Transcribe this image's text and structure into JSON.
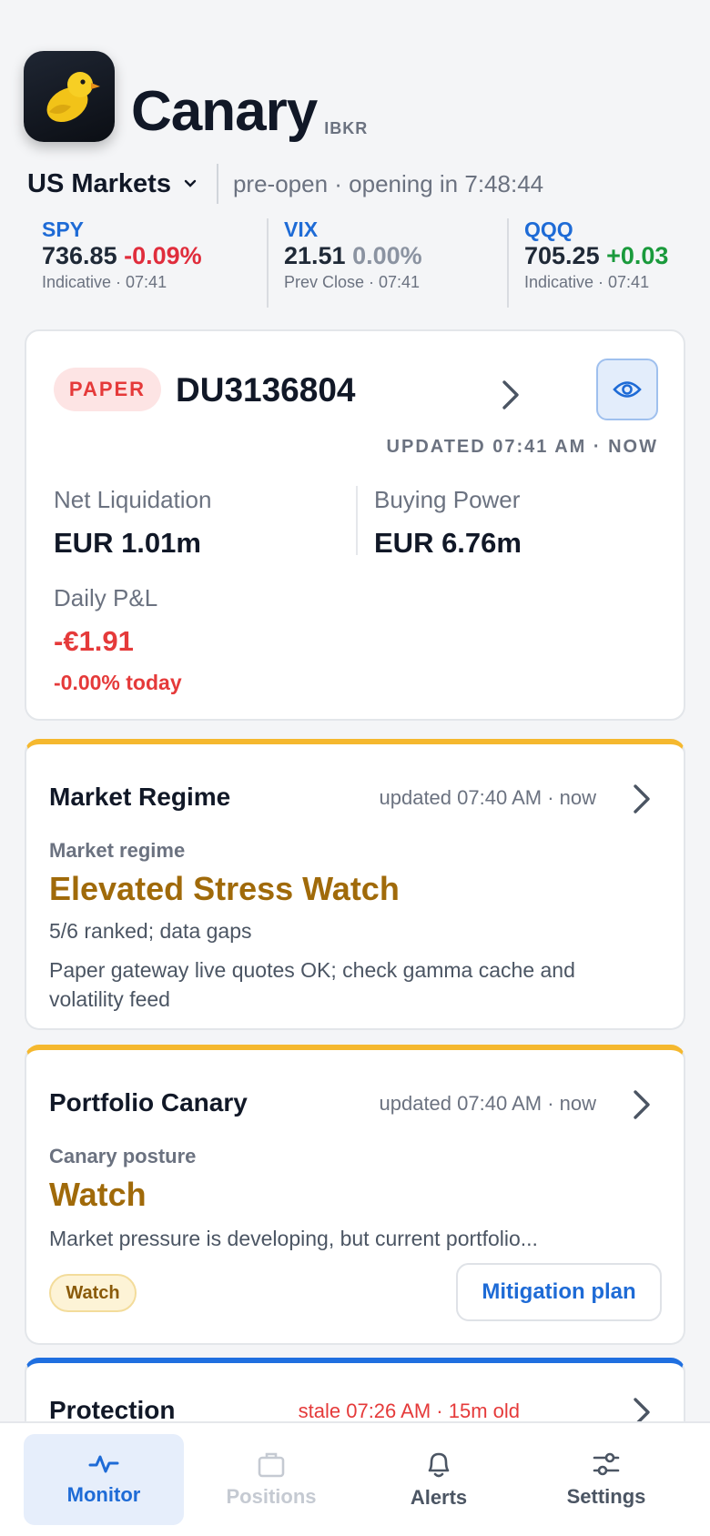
{
  "app": {
    "name": "Canary",
    "broker": "IBKR"
  },
  "market": {
    "selector": "US Markets",
    "status": "pre-open · opening in 7:48:44"
  },
  "tickers": [
    {
      "symbol": "SPY",
      "price": "736.85",
      "change": "-0.09%",
      "direction": "down",
      "sub": "Indicative · 07:41"
    },
    {
      "symbol": "VIX",
      "price": "21.51",
      "change": "0.00%",
      "direction": "flat",
      "sub": "Prev Close · 07:41"
    },
    {
      "symbol": "QQQ",
      "price": "705.25",
      "change": "+0.03",
      "direction": "up",
      "sub": "Indicative · 07:41"
    }
  ],
  "account": {
    "mode_badge": "PAPER",
    "id": "DU3136804",
    "updated": "UPDATED 07:41 AM · NOW",
    "net_liquidation_label": "Net Liquidation",
    "net_liquidation_value": "EUR 1.01m",
    "buying_power_label": "Buying Power",
    "buying_power_value": "EUR 6.76m",
    "daily_pnl_label": "Daily P&L",
    "daily_pnl_value": "-€1.91",
    "daily_pnl_pct": "-0.00% today"
  },
  "regime": {
    "title": "Market Regime",
    "updated": "updated 07:40 AM · now",
    "kicker": "Market regime",
    "headline": "Elevated Stress Watch",
    "line1": "5/6 ranked; data gaps",
    "line2": "Paper gateway live quotes OK; check gamma cache and volatility feed"
  },
  "portfolio": {
    "title": "Portfolio Canary",
    "updated": "updated 07:40 AM · now",
    "kicker": "Canary posture",
    "headline": "Watch",
    "summary": "Market pressure is developing, but current portfolio...",
    "badge": "Watch",
    "action": "Mitigation plan"
  },
  "protection": {
    "title": "Protection",
    "updated": "stale 07:26 AM · 15m old"
  },
  "tabs": [
    {
      "label": "Monitor",
      "icon": "pulse-icon",
      "state": "active"
    },
    {
      "label": "Positions",
      "icon": "briefcase-icon",
      "state": "disabled"
    },
    {
      "label": "Alerts",
      "icon": "bell-icon",
      "state": "normal"
    },
    {
      "label": "Settings",
      "icon": "sliders-icon",
      "state": "normal"
    }
  ],
  "colors": {
    "accent_blue": "#1e6bd6",
    "negative_red": "#e02d3c",
    "positive_green": "#1a9a3c",
    "amber_accent": "#f5b82e",
    "regime_text": "#a06a0a"
  }
}
